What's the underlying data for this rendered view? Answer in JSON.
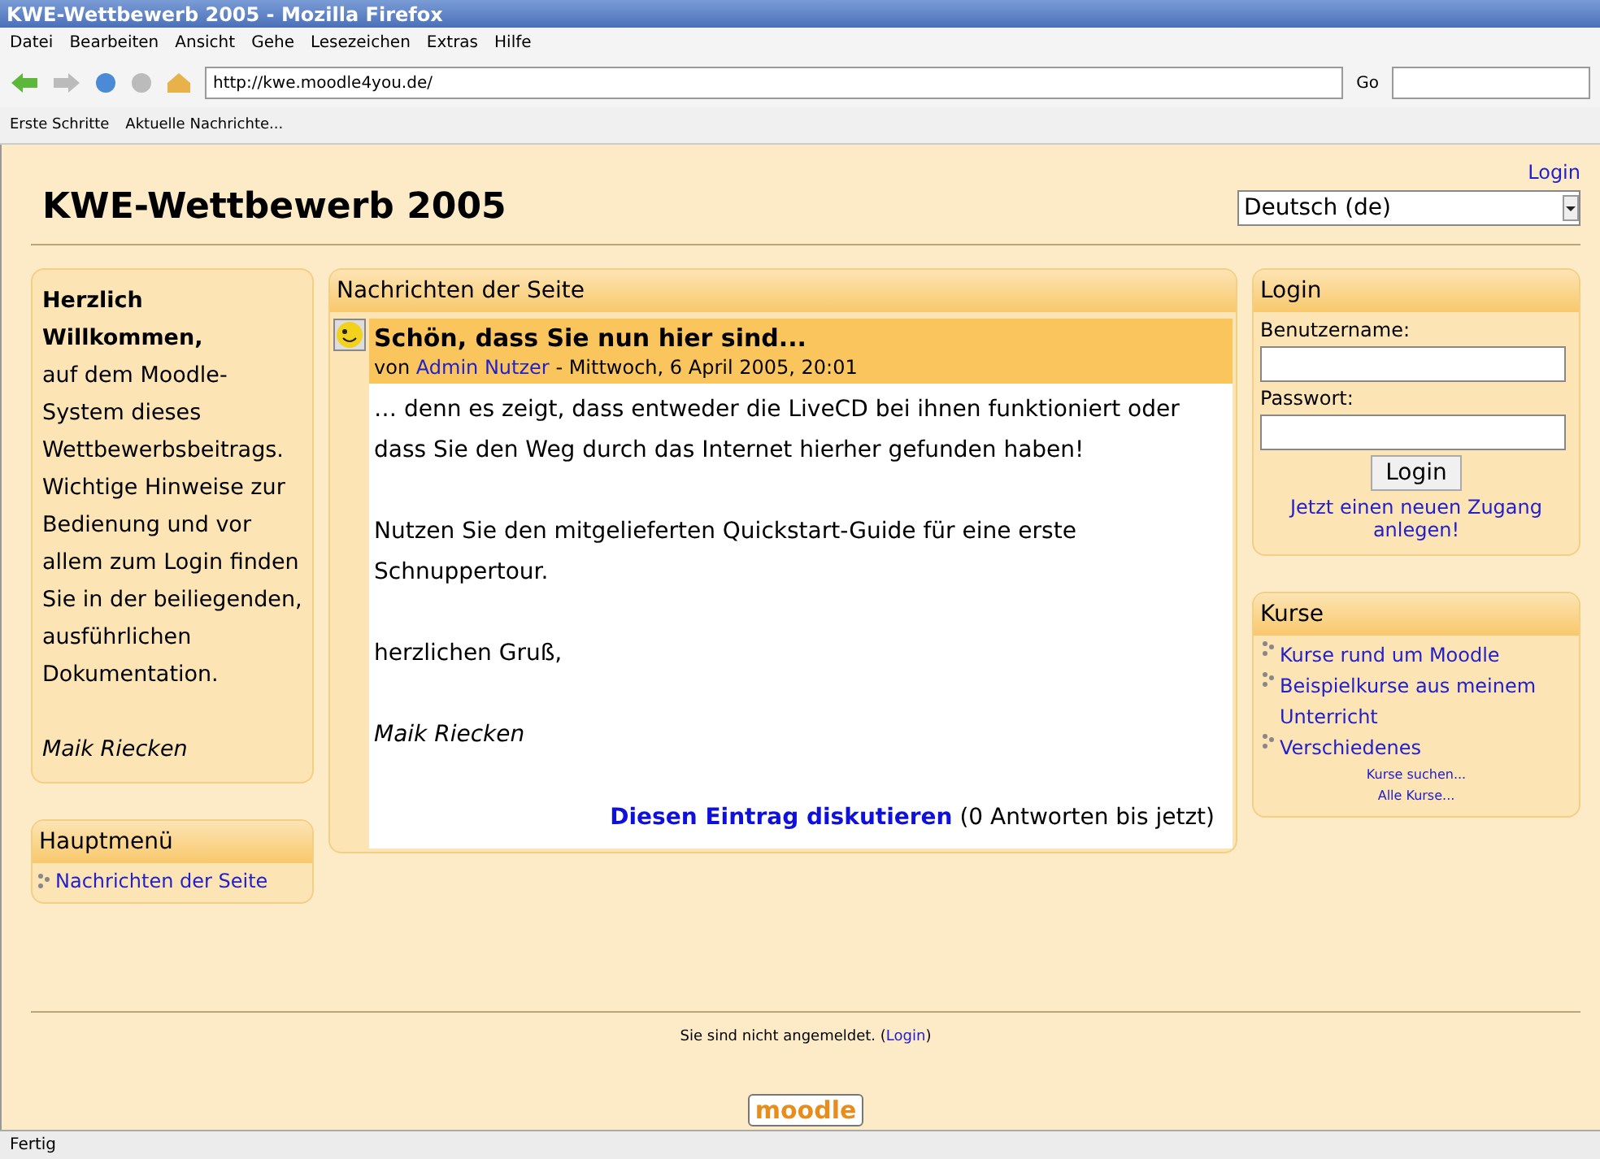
{
  "window": {
    "title": "KWE-Wettbewerb 2005 - Mozilla Firefox"
  },
  "menu_bar": [
    "Datei",
    "Bearbeiten",
    "Ansicht",
    "Gehe",
    "Lesezeichen",
    "Extras",
    "Hilfe"
  ],
  "address_bar": {
    "value": "http://kwe.moodle4you.de/",
    "go_label": "Go"
  },
  "bookmarks": [
    "Erste Schritte",
    "Aktuelle Nachrichte..."
  ],
  "page": {
    "site_title": "KWE-Wettbewerb 2005",
    "login_link": "Login",
    "language": "Deutsch (de)",
    "welcome": {
      "heading": "Herzlich Willkommen,",
      "text": "auf dem Moodle-System dieses Wettbewerbsbeitrags. Wichtige Hinweise zur Bedienung und vor allem zum Login finden Sie in der beiliegenden, ausführlichen Dokumentation.",
      "signature": "Maik Riecken"
    },
    "main_menu": {
      "title": "Hauptmenü",
      "items": [
        "Nachrichten der Seite"
      ]
    },
    "news": {
      "title": "Nachrichten der Seite",
      "post": {
        "subject": "Schön, dass Sie nun hier sind...",
        "by": "von",
        "author": "Admin Nutzer",
        "date": "- Mittwoch, 6 April 2005, 20:01",
        "paragraphs": [
          {
            "text": "… denn es zeigt, dass entweder die LiveCD bei ihnen funktioniert oder dass Sie den Weg durch das Internet hierher gefunden haben!",
            "italic": false
          },
          {
            "text": "Nutzen Sie den mitgelieferten Quickstart-Guide für eine erste Schnuppertour.",
            "italic": false
          },
          {
            "text": "herzlichen Gruß,",
            "italic": false
          },
          {
            "text": "Maik Riecken",
            "italic": true
          }
        ],
        "discuss_link": "Diesen Eintrag diskutieren",
        "replies": "(0 Antworten bis jetzt)"
      }
    },
    "login_block": {
      "title": "Login",
      "username_label": "Benutzername:",
      "password_label": "Passwort:",
      "button": "Login",
      "signup_link": "Jetzt einen neuen Zugang anlegen!"
    },
    "courses_block": {
      "title": "Kurse",
      "items": [
        "Kurse rund um Moodle",
        "Beispielkurse aus meinem Unterricht",
        "Verschiedenes"
      ],
      "search_link": "Kurse suchen...",
      "all_link": "Alle Kurse..."
    },
    "footer": {
      "text": "Sie sind nicht angemeldet. (",
      "login_link": "Login",
      "close": ")",
      "logo": "moodle"
    }
  },
  "status_bar": "Fertig"
}
